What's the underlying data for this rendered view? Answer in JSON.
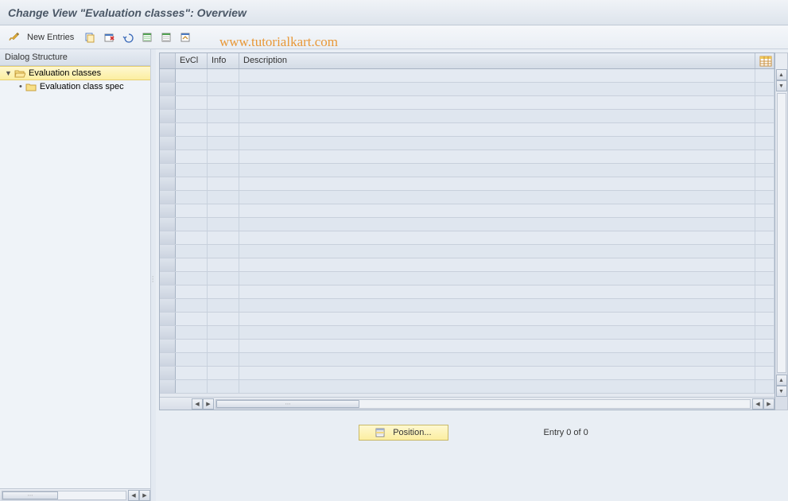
{
  "title": "Change View \"Evaluation classes\": Overview",
  "toolbar": {
    "new_entries_label": "New Entries"
  },
  "sidebar": {
    "header": "Dialog Structure",
    "items": [
      {
        "label": "Evaluation classes",
        "selected": true,
        "expanded": true
      },
      {
        "label": "Evaluation class spec",
        "child": true
      }
    ]
  },
  "table": {
    "columns": {
      "evcl": "EvCl",
      "info": "Info",
      "description": "Description"
    },
    "row_count": 24
  },
  "bottom": {
    "position_label": "Position...",
    "entry_text": "Entry 0 of 0"
  },
  "watermark": "www.tutorialkart.com"
}
